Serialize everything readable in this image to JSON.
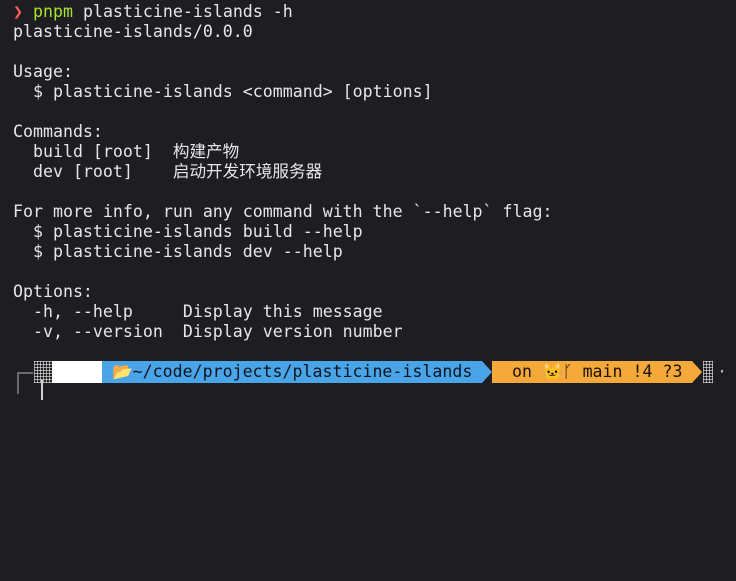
{
  "lines": {
    "l1_prompt": "❯",
    "l1_cmd": "pnpm",
    "l1_args": " plasticine-islands -h",
    "l2": "plasticine-islands/0.0.0",
    "l4": "Usage:",
    "l5": "  $ plasticine-islands <command> [options]",
    "l7": "Commands:",
    "l8": "  build [root]  构建产物",
    "l9": "  dev [root]    启动开发环境服务器",
    "l11": "For more info, run any command with the `--help` flag:",
    "l12": "  $ plasticine-islands build --help",
    "l13": "  $ plasticine-islands dev --help",
    "l15": "Options:",
    "l16": "  -h, --help     Display this message",
    "l17": "  -v, --version  Display version number"
  },
  "prompt_bar": {
    "os_icon": "",
    "folder_icon": "📂",
    "path": "~/code/projects/plasticine-islands",
    "git_text": "on 🐱ᚴ main !4 ?3",
    "trailing": "·"
  },
  "colors": {
    "background": "#1e1e22",
    "prompt_red": "#ff5f56",
    "cmd_green": "#a6e22e",
    "path_blue": "#4aa4e8",
    "git_orange": "#f5a93a"
  }
}
